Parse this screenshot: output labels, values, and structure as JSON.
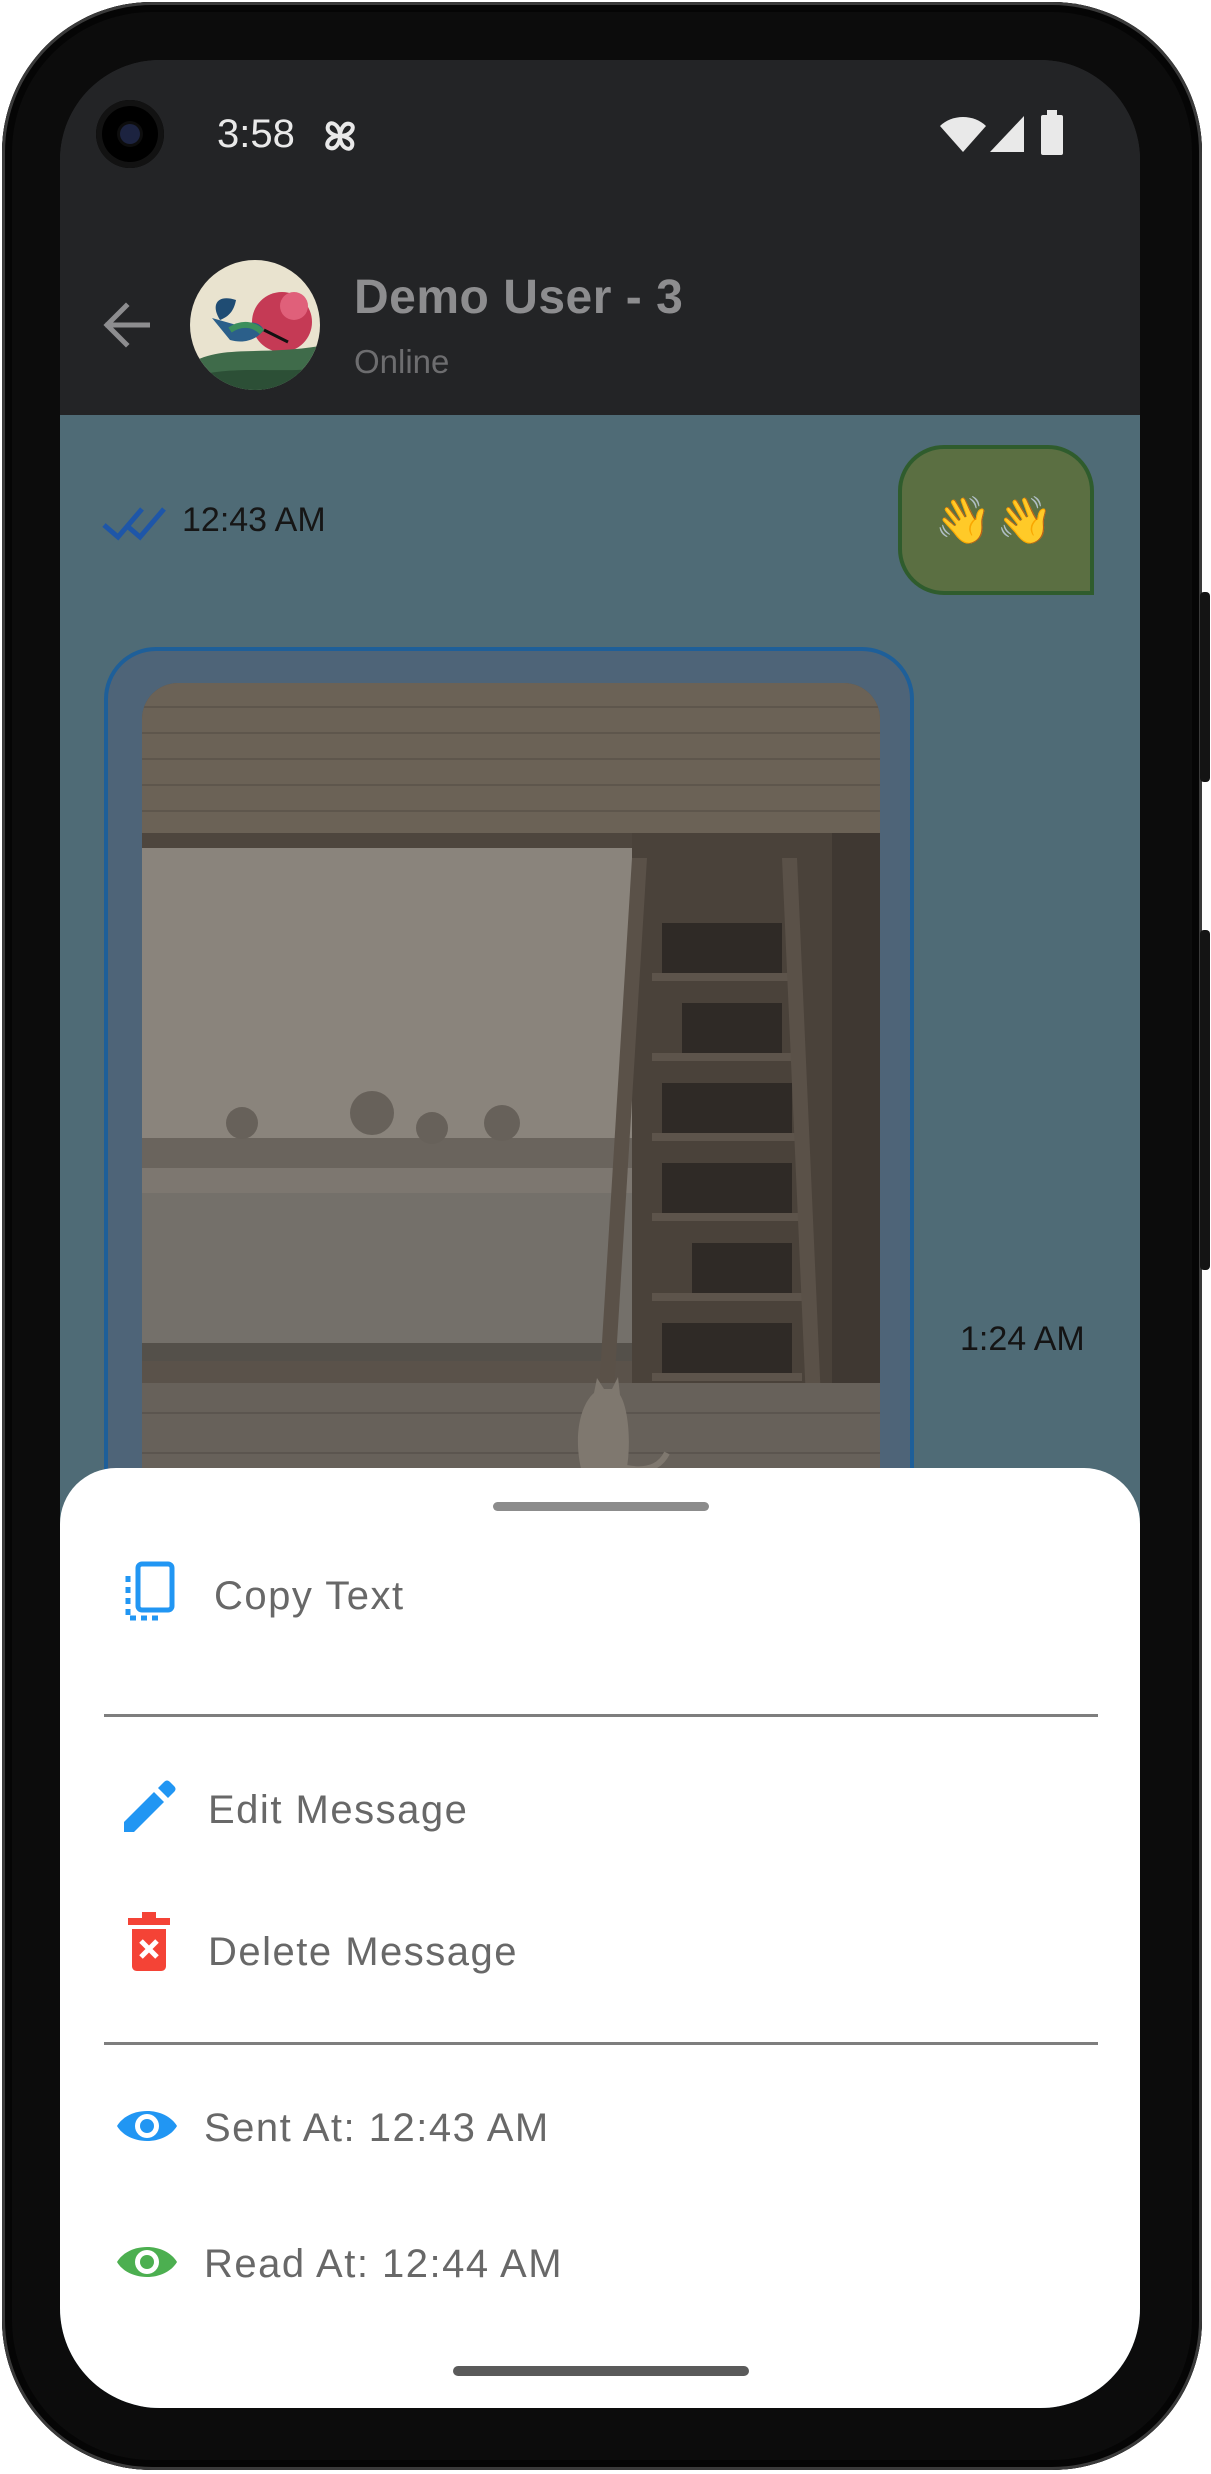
{
  "status_bar": {
    "time": "3:58"
  },
  "app_bar": {
    "title": "Demo User - 3",
    "subtitle": "Online",
    "back_icon": "arrow-back-icon",
    "avatar": "hummingbird-avatar"
  },
  "messages": [
    {
      "type": "emoji",
      "content": "👋👋",
      "time": "12:43 AM",
      "direction": "sent",
      "status": "read"
    },
    {
      "type": "image",
      "description_icon": "room-photo",
      "time": "1:24 AM",
      "direction": "received"
    }
  ],
  "sheet": {
    "items": [
      {
        "label": "Copy Text",
        "icon": "copy-icon",
        "color": "#2196f3"
      },
      {
        "label": "Edit Message",
        "icon": "pencil-icon",
        "color": "#2196f3"
      },
      {
        "label": "Delete Message",
        "icon": "trash-icon",
        "color": "#f44336"
      },
      {
        "label": "Sent At: 12:43 AM",
        "icon": "eye-icon",
        "color": "#2196f3"
      },
      {
        "label": "Read At: 12:44 AM",
        "icon": "eye-icon",
        "color": "#4caf50"
      }
    ]
  },
  "colors": {
    "accent_blue": "#2196f3",
    "delete_red": "#f44336",
    "read_green": "#4caf50",
    "chat_background": "#4f6b76",
    "app_bar": "#232426"
  }
}
